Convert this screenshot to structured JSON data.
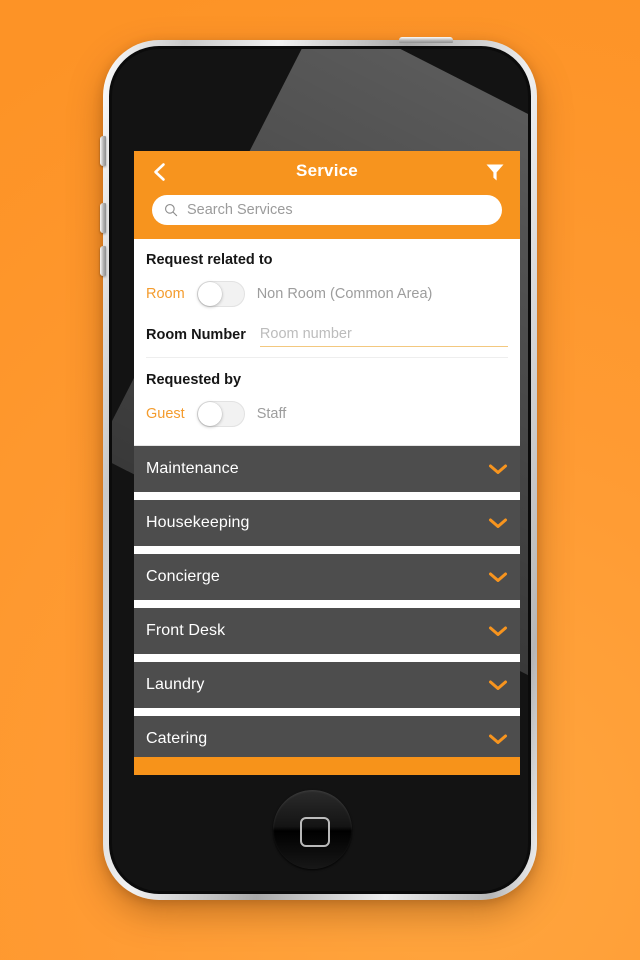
{
  "theme": {
    "brand_orange": "#F7941E",
    "background_orange": "#FF9833",
    "row_gray": "#4D4D4D",
    "chevron_orange": "#F7941E",
    "active_label_orange": "#F49C2E",
    "inactive_label_gray": "#9D9D9D"
  },
  "header": {
    "title": "Service",
    "back_icon": "chevron-left-icon",
    "filter_icon": "funnel-filter-icon"
  },
  "search": {
    "icon": "search-icon",
    "placeholder": "Search Services",
    "value": ""
  },
  "form": {
    "request_related_to": {
      "title": "Request related to",
      "toggle": {
        "left_label": "Room",
        "right_label": "Non Room (Common Area)",
        "state": "left",
        "selected": "Room"
      },
      "room_number": {
        "label": "Room Number",
        "placeholder": "Room number",
        "value": ""
      }
    },
    "requested_by": {
      "title": "Requested by",
      "toggle": {
        "left_label": "Guest",
        "right_label": "Staff",
        "state": "left",
        "selected": "Guest"
      }
    }
  },
  "categories": [
    {
      "label": "Maintenance",
      "expanded": false,
      "chevron": "chevron-down-icon"
    },
    {
      "label": "Housekeeping",
      "expanded": false,
      "chevron": "chevron-down-icon"
    },
    {
      "label": "Concierge",
      "expanded": false,
      "chevron": "chevron-down-icon"
    },
    {
      "label": "Front Desk",
      "expanded": false,
      "chevron": "chevron-down-icon"
    },
    {
      "label": "Laundry",
      "expanded": false,
      "chevron": "chevron-down-icon"
    },
    {
      "label": "Catering",
      "expanded": false,
      "chevron": "chevron-down-icon"
    }
  ]
}
